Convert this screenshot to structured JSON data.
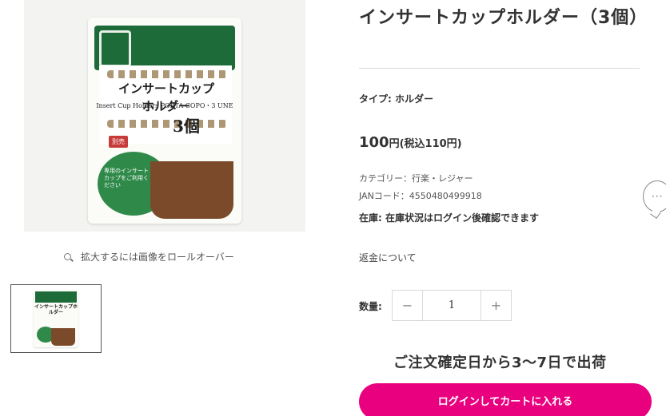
{
  "product": {
    "title": "インサートカップホルダー（3個）",
    "type_label": "タイプ:",
    "type_value": "ホルダー",
    "price_main": "100",
    "price_suffix": "円(税込110円)",
    "category": "カテゴリー：行楽・レジャー",
    "jan": "JANコード：4550480499918",
    "stock_label": "在庫:",
    "stock_value": "在庫状況はログイン後確認できます",
    "refund_link": "返金について"
  },
  "gallery": {
    "zoom_hint": "拡大するには画像をロールオーバー",
    "package_title_line1": "インサートカップ",
    "package_title_line2": "ホルダー",
    "package_en": "Insert Cup Holders  PORTA COPO・3 UNE",
    "package_count": "3個",
    "package_tag": "別売",
    "package_note": "専用のインサートカップをご利用ください",
    "thumb_label": "インサートカップホルダー",
    "thumb_count": "3個"
  },
  "quantity": {
    "label": "数量:",
    "minus": "−",
    "value": "1",
    "plus": "+"
  },
  "shipping": {
    "text": "ご注文確定日から3〜7日で出荷"
  },
  "cart": {
    "button_label": "ログインしてカートに入れる"
  },
  "chat": {
    "glyph": "···"
  },
  "colors": {
    "accent": "#e8007f",
    "package_green": "#1e6b3a"
  }
}
